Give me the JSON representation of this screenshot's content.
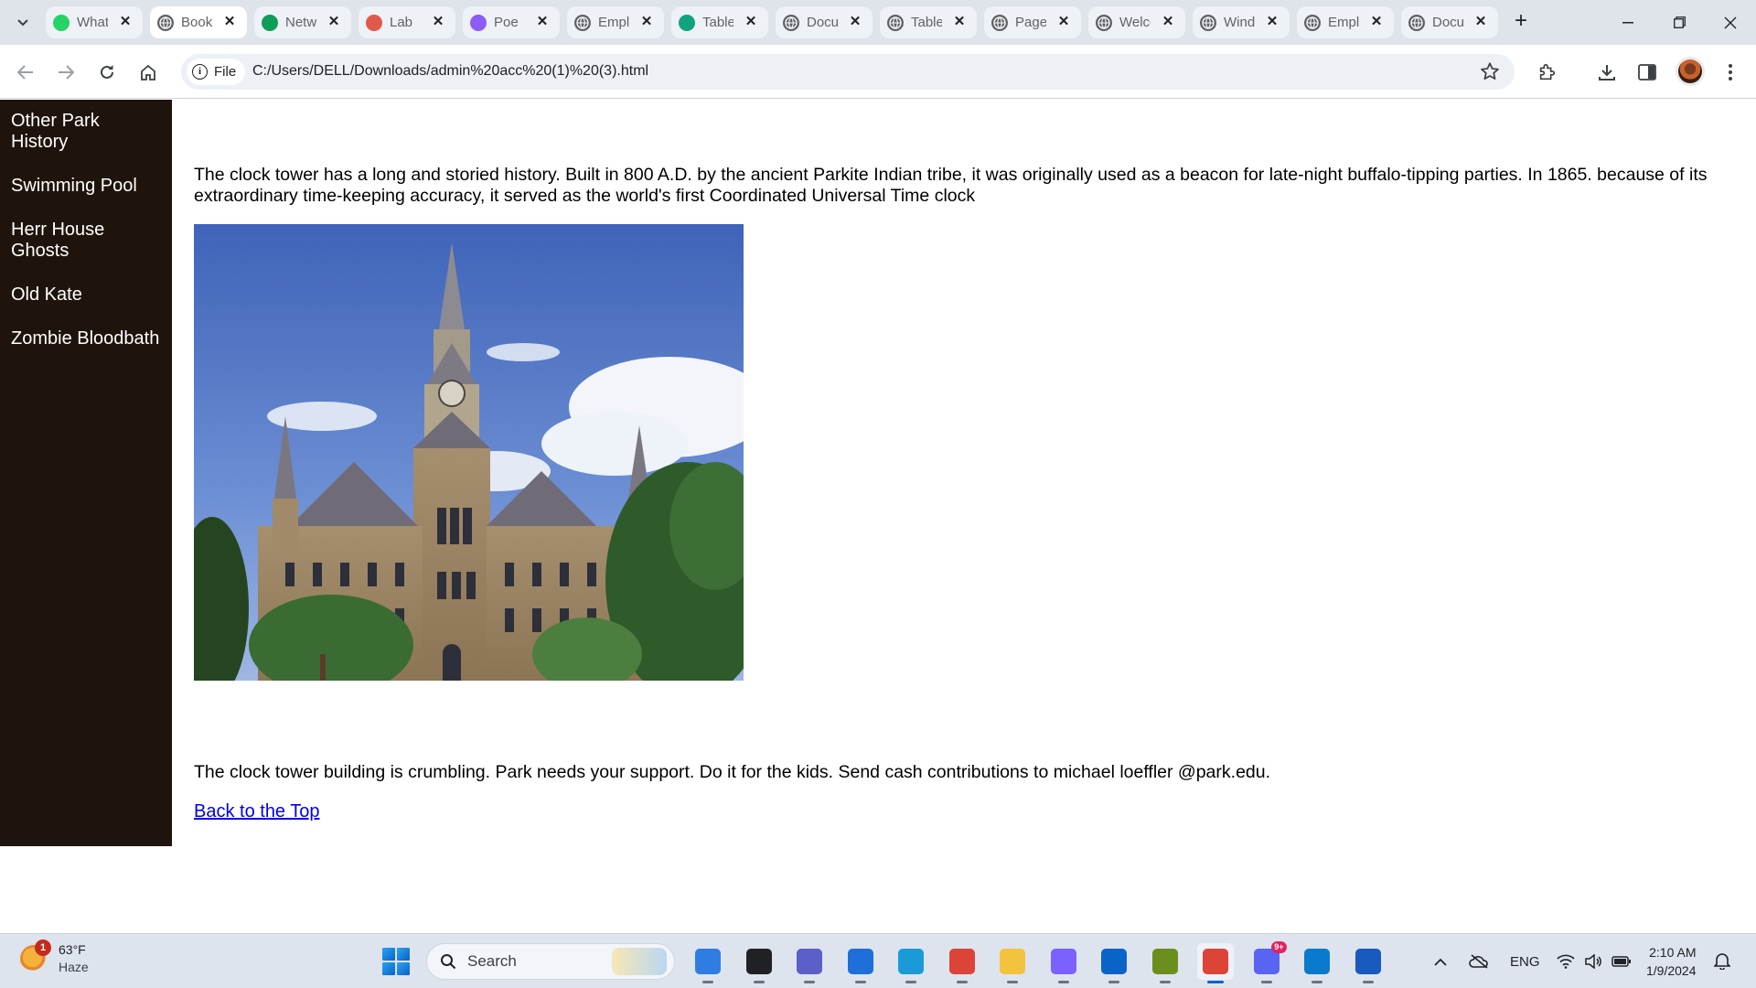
{
  "browser": {
    "tabs": [
      {
        "title": "WhatsApp",
        "favicon_color": "#25d366",
        "favicon": "whatsapp-icon"
      },
      {
        "title": "Book",
        "favicon_color": "#5f6368",
        "favicon": "globe-icon",
        "active": true
      },
      {
        "title": "Network",
        "favicon_color": "#0f9d58",
        "favicon": "plus-cross-icon"
      },
      {
        "title": "Lab",
        "favicon_color": "#e05a4b",
        "favicon": "gear-flower-icon"
      },
      {
        "title": "Poe",
        "favicon_color": "#8b5cf6",
        "favicon": "chat-bubble-icon"
      },
      {
        "title": "Employee",
        "favicon_color": "#5f6368",
        "favicon": "globe-icon"
      },
      {
        "title": "Table",
        "favicon_color": "#10a37f",
        "favicon": "openai-icon"
      },
      {
        "title": "Document",
        "favicon_color": "#5f6368",
        "favicon": "globe-icon"
      },
      {
        "title": "Table",
        "favicon_color": "#5f6368",
        "favicon": "globe-icon"
      },
      {
        "title": "Page",
        "favicon_color": "#5f6368",
        "favicon": "globe-icon"
      },
      {
        "title": "Welcome",
        "favicon_color": "#5f6368",
        "favicon": "globe-icon"
      },
      {
        "title": "Window",
        "favicon_color": "#5f6368",
        "favicon": "globe-icon"
      },
      {
        "title": "Employee",
        "favicon_color": "#5f6368",
        "favicon": "globe-icon"
      },
      {
        "title": "Document",
        "favicon_color": "#5f6368",
        "favicon": "globe-icon"
      }
    ],
    "new_tab_label": "+",
    "address": {
      "scheme_label": "File",
      "url": "C:/Users/DELL/Downloads/admin%20acc%20(1)%20(3).html"
    }
  },
  "page": {
    "nav": [
      "Other Park History",
      "Swimming Pool",
      "Herr House Ghosts",
      "Old Kate",
      "Zombie Bloodbath"
    ],
    "intro": "The clock tower has a long and storied history. Built in 800 A.D. by the ancient Parkite Indian tribe, it was originally used as a beacon for late-night buffalo-tipping parties. In 1865. because of its extraordinary time-keeping accuracy, it served as the world's first Coordinated Universal Time clock",
    "appeal": "The clock tower building is crumbling. Park needs your support. Do it for the kids. Send cash contributions to michael loeffler @park.edu.",
    "back_link": "Back to the Top"
  },
  "taskbar": {
    "weather": {
      "temp": "63°F",
      "condition": "Haze",
      "badge": "1"
    },
    "search_label": "Search",
    "apps": [
      {
        "name": "copilot-icon",
        "color": "#2f7de1"
      },
      {
        "name": "task-view-icon",
        "color": "#202124"
      },
      {
        "name": "teams-meet-icon",
        "color": "#5b5fc7"
      },
      {
        "name": "store-icon",
        "color": "#1e6fd9"
      },
      {
        "name": "edge-icon",
        "color": "#1a9bd7"
      },
      {
        "name": "chrome-icon",
        "color": "#db4437"
      },
      {
        "name": "file-explorer-icon",
        "color": "#f4c33d"
      },
      {
        "name": "copilot-app-icon",
        "color": "#7b61ff"
      },
      {
        "name": "mail-icon",
        "color": "#0a64c8"
      },
      {
        "name": "lambda-app-icon",
        "color": "#6a8f1f"
      },
      {
        "name": "chrome-profile-icon",
        "color": "#db4437",
        "active": true
      },
      {
        "name": "discord-icon",
        "color": "#5865f2",
        "badge": "9+"
      },
      {
        "name": "vscode-icon",
        "color": "#0a7acc"
      },
      {
        "name": "word-icon",
        "color": "#185abd"
      }
    ],
    "tray": {
      "language": "ENG"
    },
    "clock": {
      "time": "2:10 AM",
      "date": "1/9/2024"
    }
  }
}
